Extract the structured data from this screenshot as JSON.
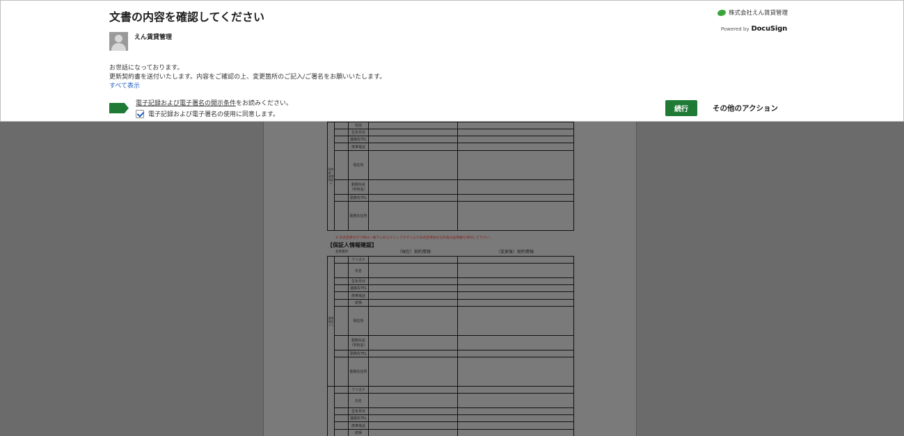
{
  "header": {
    "title": "文書の内容を確認してください",
    "brand_name": "株式会社えん賃貸管理",
    "powered_prefix": "Powered by",
    "powered_brand": "DocuSign",
    "sender_name": "えん賃貸管理",
    "message_line1": "お世話になっております。",
    "message_line2": "更新契約書を送付いたします。内容をご確認の上、変更箇所のご記入/ご署名をお願いいたします。",
    "show_all": "すべて表示",
    "disclosure_link": "電子記録および電子署名の開示条件",
    "disclosure_suffix": "をお読みください。",
    "agree_label": "電子記録および電子署名の使用に同意します。",
    "continue_label": "続行",
    "more_actions_label": "その他のアクション"
  },
  "document": {
    "table1": {
      "side_label": "契約者・連帯保証人",
      "rows": [
        "性別",
        "生年月日",
        "連絡先TEL",
        "携帯電話",
        "現住所",
        "勤務先名（学校名）",
        "勤務先TEL",
        "勤務先住所"
      ]
    },
    "note": "※ 氏名変更を行う際は一番下にあるクリップボタンより氏名変更後の公的身分証明書を添付して下さい。",
    "section_title": "【保証人情報確認】",
    "subnote": "変更箇所",
    "col_current": "（現在）契約情報",
    "col_new": "（変更後）契約情報",
    "table2": {
      "side_label": "連帯保証人１",
      "rows": [
        "フリガナ",
        "氏名",
        "生年月日",
        "連絡先TEL",
        "携帯電話",
        "続柄",
        "現住所",
        "勤務先名（学校名）",
        "勤務先TEL",
        "勤務先住所"
      ]
    },
    "table3": {
      "rows": [
        "フリガナ",
        "氏名",
        "生年月日",
        "連絡先TEL",
        "携帯電話",
        "続柄"
      ]
    }
  }
}
